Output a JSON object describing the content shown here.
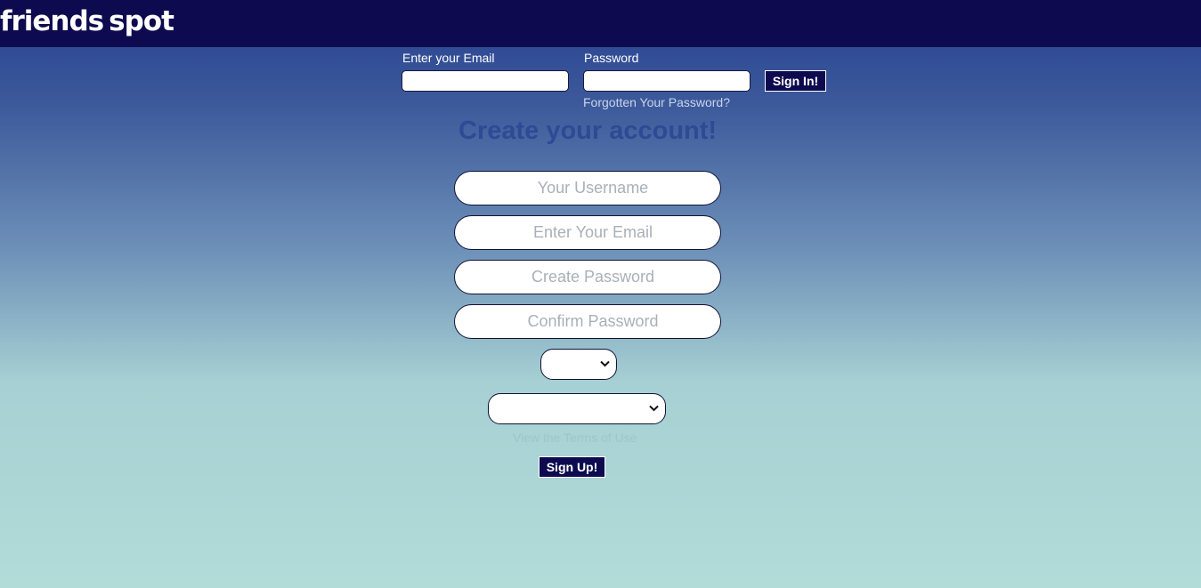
{
  "header": {
    "logo_part1": "friends",
    "logo_part2": "spot"
  },
  "signin": {
    "email_label": "Enter your Email",
    "password_label": "Password",
    "button_label": "Sign In!",
    "forgot_link": "Forgotten Your Password?"
  },
  "signup": {
    "heading": "Create your account!",
    "username_placeholder": "Your Username",
    "email_placeholder": "Enter Your Email",
    "password_placeholder": "Create Password",
    "confirm_placeholder": "Confirm Password",
    "select1_value": "",
    "select2_value": "",
    "terms_link": "View the Terms of Use",
    "button_label": "Sign Up!"
  },
  "colors": {
    "navbar": "#0e0a4f",
    "heading": "#2e4a96",
    "button": "#0e0a4f"
  }
}
